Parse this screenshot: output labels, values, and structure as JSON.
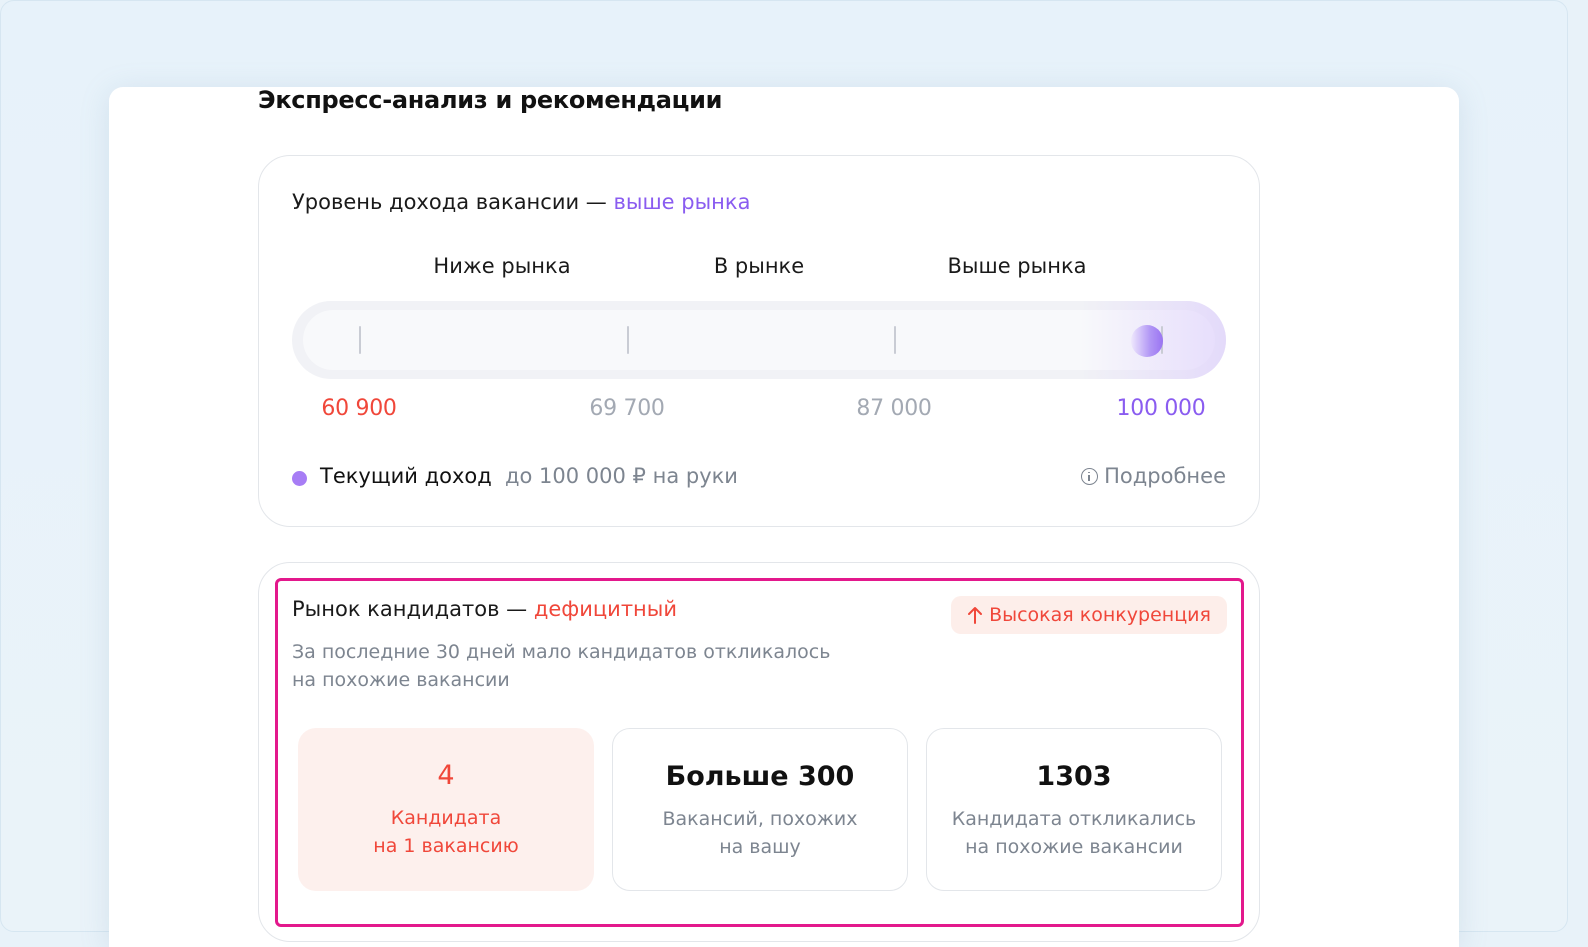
{
  "page": {
    "title": "Экспресс-анализ и рекомендации"
  },
  "income": {
    "title_prefix": "Уровень дохода вакансии —",
    "status": "выше рынка",
    "scale_labels": [
      "Ниже рынка",
      "В рынке",
      "Выше рынка"
    ],
    "scale_values": [
      "60 900",
      "69 700",
      "87 000",
      "100 000"
    ],
    "scale_value_colors": [
      "#f0473a",
      "#a3a9b3",
      "#a3a9b3",
      "#8a5cf0"
    ],
    "current_label": "Текущий доход",
    "current_value": "до 100 000 ₽ на руки",
    "more_link": "Подробнее",
    "marker_value": 100000,
    "icons": {
      "more": "info-icon"
    }
  },
  "market": {
    "title_prefix": "Рынок кандидатов —",
    "status": "дефицитный",
    "badge": "Высокая конкуренция",
    "description_lines": [
      "За последние 30 дней мало кандидатов откликалось",
      "на похожие вакансии"
    ],
    "stats": [
      {
        "value": "4",
        "caption_lines": [
          "Кандидата",
          "на 1 вакансию"
        ]
      },
      {
        "value": "Больше 300",
        "caption_lines": [
          "Вакансий, похожих",
          "на вашу"
        ]
      },
      {
        "value": "1303",
        "caption_lines": [
          "Кандидата откликались",
          "на похожие вакансии"
        ]
      }
    ],
    "icons": {
      "badge": "arrow-up-icon"
    }
  },
  "colors": {
    "accent_violet": "#8a5cf0",
    "accent_red": "#f0473a",
    "highlight": "#e3188c"
  }
}
